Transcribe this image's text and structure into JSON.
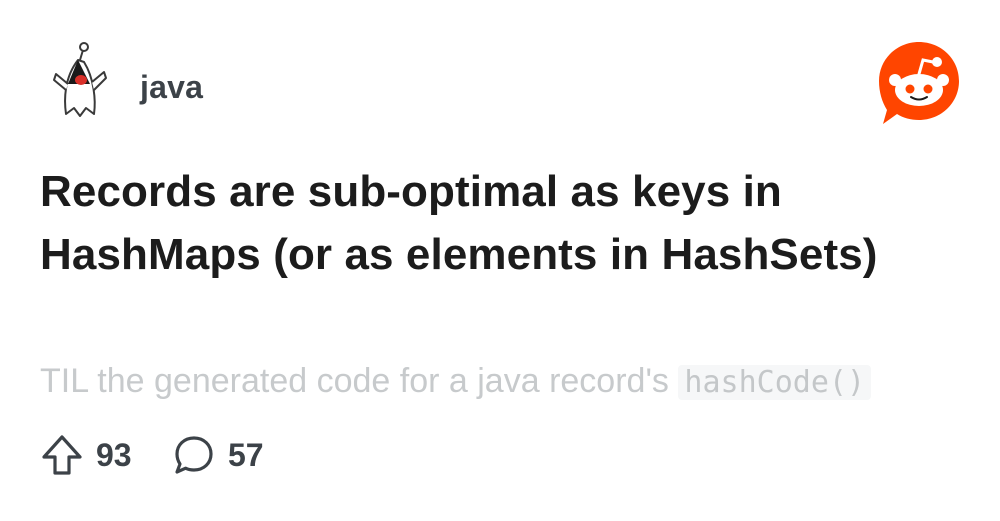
{
  "subreddit": {
    "name": "java",
    "icon": "duke-mascot-icon"
  },
  "brand": {
    "icon": "reddit-snoo-logo",
    "accent_color": "#ff4500"
  },
  "post": {
    "title": "Records are sub-optimal as keys in HashMaps (or as elements in HashSets)",
    "preview_text": "TIL the generated code for a java record's ",
    "preview_code": "hashCode()"
  },
  "stats": {
    "upvote_icon": "upvote-arrow-icon",
    "upvotes": "93",
    "comment_icon": "comment-bubble-icon",
    "comments": "57"
  }
}
